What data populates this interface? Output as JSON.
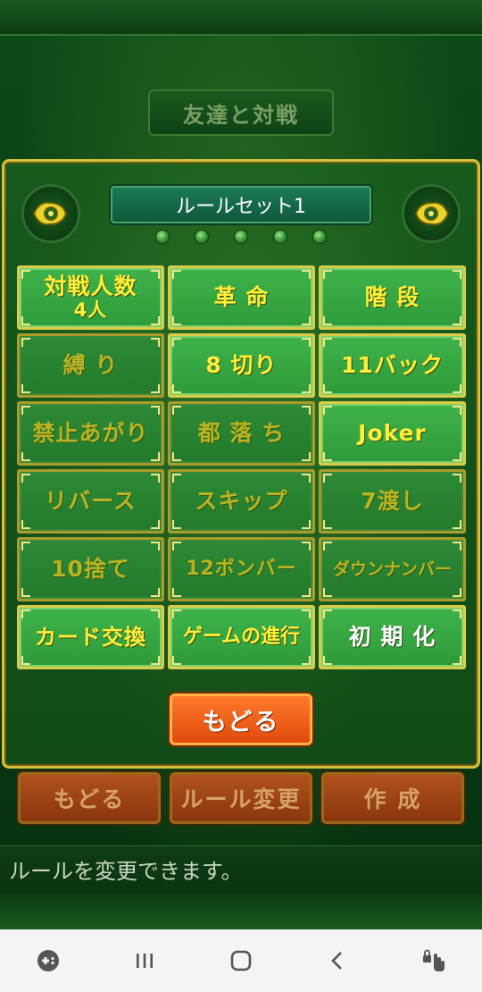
{
  "header": {
    "title": "友達と対戦"
  },
  "ruleset": {
    "name": "ルールセット1",
    "page_dots": 5
  },
  "rules": [
    {
      "label_line1": "対戦人数",
      "label_line2": "4人",
      "state": "on"
    },
    {
      "label_line1": "革 命",
      "state": "on"
    },
    {
      "label_line1": "階 段",
      "state": "on"
    },
    {
      "label_line1": "縛 り",
      "state": "off"
    },
    {
      "label_line1": "8 切り",
      "state": "on"
    },
    {
      "label_line1": "11バック",
      "state": "on"
    },
    {
      "label_line1": "禁止あがり",
      "state": "off"
    },
    {
      "label_line1": "都 落 ち",
      "state": "off"
    },
    {
      "label_line1": "Joker",
      "state": "on"
    },
    {
      "label_line1": "リバース",
      "state": "off"
    },
    {
      "label_line1": "スキップ",
      "state": "off"
    },
    {
      "label_line1": "7渡し",
      "state": "off"
    },
    {
      "label_line1": "10捨て",
      "state": "off"
    },
    {
      "label_line1": "12ボンバー",
      "state": "off"
    },
    {
      "label_line1": "ダウンナンバー",
      "state": "off"
    },
    {
      "label_line1": "カード交換",
      "state": "on"
    },
    {
      "label_line1": "ゲームの進行",
      "state": "on"
    },
    {
      "label_line1": "初 期 化",
      "state": "white"
    }
  ],
  "panel": {
    "back_label": "もどる"
  },
  "bottom_buttons": {
    "back": "もどる",
    "change_rules": "ルール変更",
    "create": "作 成"
  },
  "message": "ルールを変更できます。",
  "colors": {
    "accent_gold": "#d9cc48",
    "on_text": "#ffef3a",
    "button_orange": "#e04a0c"
  }
}
